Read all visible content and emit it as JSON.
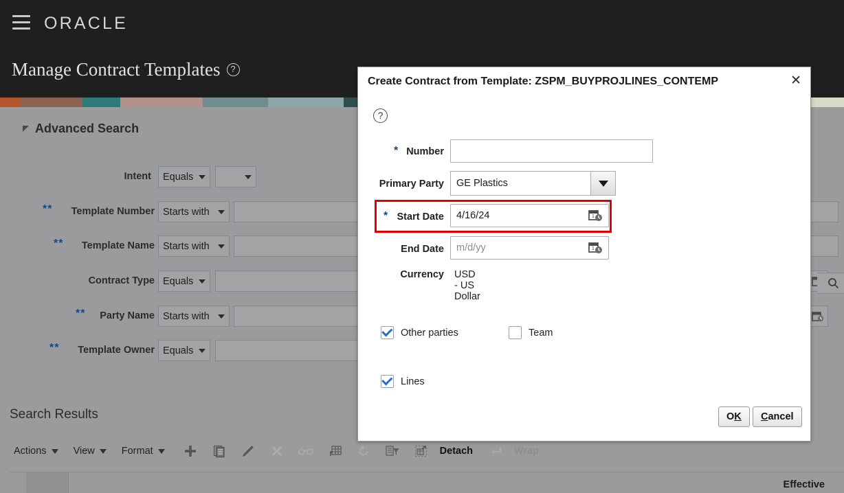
{
  "header": {
    "menu_icon": "hamburger-menu-icon",
    "brand": "ORACLE",
    "page_title": "Manage Contract Templates",
    "help_icon": "help-icon"
  },
  "banner": {
    "colors": [
      "#b3542a",
      "#8d6252",
      "#2b7b76",
      "#b2918b",
      "#6f8d90",
      "#8fa6a8",
      "#2f4f4c",
      "#243f3d",
      "#d8d9c6"
    ]
  },
  "advanced_search": {
    "title": "Advanced Search",
    "rows": [
      {
        "stars": "",
        "label": "Intent",
        "operator": "Equals",
        "value": "",
        "type": "select-pair"
      },
      {
        "stars": "**",
        "label": "Template Number",
        "operator": "Starts with",
        "value": "",
        "type": "text"
      },
      {
        "stars": "**",
        "label": "Template Name",
        "operator": "Starts with",
        "value": "",
        "type": "text"
      },
      {
        "stars": "",
        "label": "Contract Type",
        "operator": "Equals",
        "value": "",
        "type": "text-wide"
      },
      {
        "stars": "**",
        "label": "Party Name",
        "operator": "Starts with",
        "value": "",
        "type": "text"
      },
      {
        "stars": "**",
        "label": "Template Owner",
        "operator": "Equals",
        "value": "",
        "type": "text-wide"
      }
    ],
    "search_icon": "search-icon",
    "date_picker_icon": "calendar-clock-icon"
  },
  "results": {
    "title": "Search Results",
    "toolbar": {
      "menus": [
        {
          "label": "Actions",
          "icon": "chevron-down-icon"
        },
        {
          "label": "View",
          "icon": "chevron-down-icon"
        },
        {
          "label": "Format",
          "icon": "chevron-down-icon"
        }
      ],
      "icons": [
        {
          "name": "add-icon",
          "enabled": true
        },
        {
          "name": "duplicate-icon",
          "enabled": true
        },
        {
          "name": "edit-pencil-icon",
          "enabled": true
        },
        {
          "name": "delete-x-icon",
          "enabled": false
        },
        {
          "name": "view-glasses-icon",
          "enabled": false
        },
        {
          "name": "freeze-grid-icon",
          "enabled": true
        },
        {
          "name": "refresh-icon",
          "enabled": false
        },
        {
          "name": "detach-filter-icon",
          "enabled": true
        }
      ],
      "detach_icon": "detach-icon",
      "detach_label": "Detach",
      "wrap_icon": "wrap-icon",
      "wrap_label": "Wrap"
    },
    "columns": [
      "Effective"
    ]
  },
  "dialog": {
    "title": "Create Contract from Template: ZSPM_BUYPROJLINES_CONTEMP",
    "close_icon": "close-icon",
    "help_icon": "help-icon",
    "fields": {
      "number": {
        "label": "Number",
        "required": true,
        "value": "",
        "placeholder": ""
      },
      "primary_party": {
        "label": "Primary Party",
        "required": false,
        "value": "GE Plastics",
        "dropdown_icon": "dropdown-triangle-icon"
      },
      "start_date": {
        "label": "Start Date",
        "required": true,
        "value": "4/16/24",
        "icon": "calendar-clock-icon",
        "highlight_color": "#e10000"
      },
      "end_date": {
        "label": "End Date",
        "required": false,
        "value": "",
        "placeholder": "m/d/yy",
        "icon": "calendar-clock-icon"
      },
      "currency": {
        "label": "Currency",
        "value": "USD - US Dollar"
      }
    },
    "checkboxes": [
      {
        "label": "Other parties",
        "checked": true
      },
      {
        "label": "Team",
        "checked": false
      },
      {
        "label": "Lines",
        "checked": true
      }
    ],
    "buttons": {
      "ok": {
        "prefix": "O",
        "accesskey": "K",
        "suffix": ""
      },
      "cancel": {
        "prefix": "",
        "accesskey": "C",
        "suffix": "ancel"
      }
    }
  }
}
